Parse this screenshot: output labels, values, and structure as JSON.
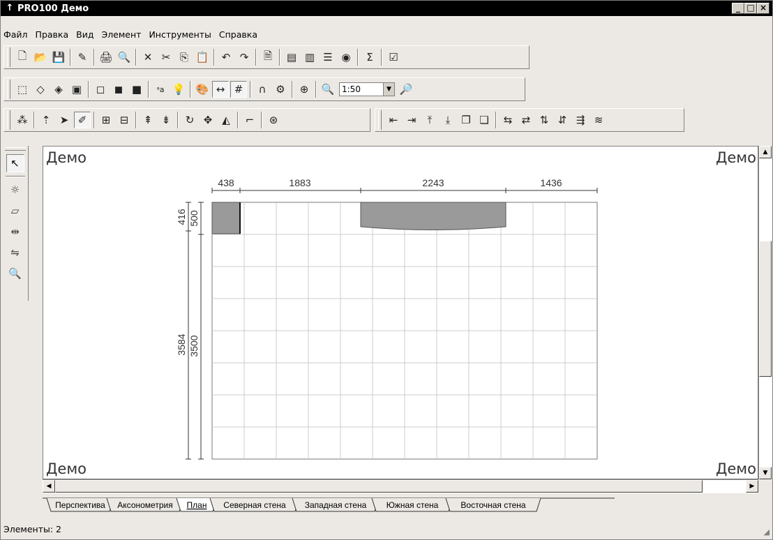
{
  "window": {
    "title": "PRO100 Демо"
  },
  "menu": [
    "Файл",
    "Правка",
    "Вид",
    "Элемент",
    "Инструменты",
    "Справка"
  ],
  "toolbar_zoom": {
    "value": "1:50"
  },
  "canvas": {
    "corner_label": "Демо",
    "dimensions_top": [
      "438",
      "1883",
      "2243",
      "1436"
    ],
    "dimensions_left": {
      "upper_outer": "416",
      "upper_inner": "500",
      "lower_outer": "3584",
      "lower_inner": "3500"
    }
  },
  "tabs": [
    {
      "label": "Перспектива",
      "active": false
    },
    {
      "label": "Аксонометрия",
      "active": false
    },
    {
      "label": "План",
      "active": true
    },
    {
      "label": "Северная стена",
      "active": false
    },
    {
      "label": "Западная стена",
      "active": false
    },
    {
      "label": "Южная стена",
      "active": false
    },
    {
      "label": "Восточная стена",
      "active": false
    }
  ],
  "status": {
    "text": "Элементы: 2"
  },
  "icons": {
    "app": "pin-icon",
    "toolbar1": [
      "new-icon",
      "open-icon",
      "save-icon",
      "properties-icon",
      "print-icon",
      "print-preview-icon",
      "delete-icon",
      "cut-icon",
      "copy-icon",
      "paste-icon",
      "undo-icon",
      "redo-icon",
      "project-info-icon",
      "material-icon",
      "material-alt-icon",
      "list-icon",
      "info-icon",
      "sum-icon",
      "report-icon"
    ],
    "toolbar2": [
      "view-wire-icon",
      "view-outline-icon",
      "view-solid-icon",
      "view-shaded-icon",
      "view-box1-icon",
      "view-box2-icon",
      "view-filled-icon",
      "text-icon",
      "light-icon",
      "palette-icon",
      "dimension-icon",
      "grid-icon",
      "magnet-icon",
      "render-icon",
      "target-icon",
      "zoom-in-icon",
      "zoom-out-icon"
    ],
    "toolbar3": [
      "select-all-icon",
      "raise-icon",
      "pointer-move-icon",
      "pointer-edit-icon",
      "size-icon",
      "size-alt-icon",
      "move-up-icon",
      "move-down-icon",
      "rotate-icon",
      "move-icon",
      "mirror-icon",
      "corner-icon",
      "snap-icon",
      "align-left-icon",
      "align-right-icon",
      "align-top-icon",
      "align-bottom-icon",
      "group-icon",
      "ungroup-icon",
      "distribute-h-icon",
      "distribute-v-icon",
      "distribute-t-icon",
      "distribute-b-icon",
      "sort-icon",
      "stack-icon"
    ],
    "left": [
      "arrow-select-icon",
      "light-icon",
      "box-icon",
      "dimension-icon",
      "distribute-icon",
      "zoom-icon"
    ]
  }
}
